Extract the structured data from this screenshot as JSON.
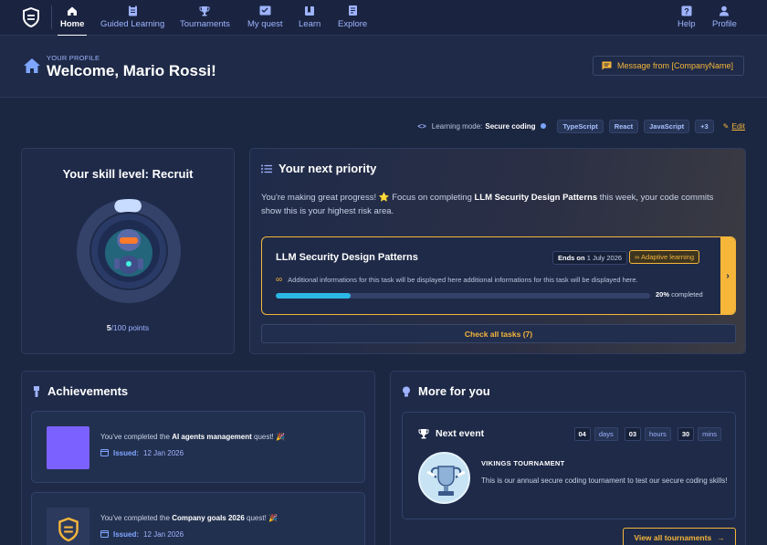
{
  "nav": {
    "items": [
      {
        "label": "Home",
        "icon": "home-icon",
        "active": true
      },
      {
        "label": "Guided Learning",
        "icon": "clipboard-icon"
      },
      {
        "label": "Tournaments",
        "icon": "trophy-icon"
      },
      {
        "label": "My quest",
        "icon": "quest-icon"
      },
      {
        "label": "Learn",
        "icon": "book-icon"
      },
      {
        "label": "Explore",
        "icon": "document-icon"
      }
    ],
    "right": [
      {
        "label": "Help",
        "icon": "help-icon"
      },
      {
        "label": "Profile",
        "icon": "user-icon"
      }
    ]
  },
  "header": {
    "kicker": "YOUR PROFILE",
    "welcome": "Welcome, Mario Rossi!",
    "message_button": "Message from [CompanyName]"
  },
  "mode": {
    "label": "Learning mode:",
    "value": "Secure coding",
    "chips": [
      "TypeScript",
      "React",
      "JavaScript",
      "+3"
    ],
    "edit": "Edit"
  },
  "skill": {
    "title": "Your skill level: Recruit",
    "points_value": "5",
    "points_rest": "/100 points",
    "progress": 0.05
  },
  "priority": {
    "title": "Your next priority",
    "text_a": "You're making great progress! ⭐ Focus on completing ",
    "text_bold": "LLM Security Design Patterns",
    "text_b": " this week, your code commits show this is your highest risk area.",
    "task": {
      "title": "LLM Security Design Patterns",
      "ends_label": "Ends on",
      "ends_date": "1 July 2026",
      "adaptive": "Adaptive learning",
      "info": "Additional informations for this task will be displayed here additional informations for this task will be displayed here.",
      "progress_percent": 20,
      "pct_value": "20%",
      "pct_label": "completed"
    },
    "check_all": "Check all tasks (7)"
  },
  "achievements": {
    "title": "Achievements",
    "items": [
      {
        "pre": "You've completed the ",
        "bold": "AI agents management",
        "post": " quest! 🎉",
        "issued_label": "Issued:",
        "date": "12 Jan 2026",
        "badge_color": "#7b61ff"
      },
      {
        "pre": "You've completed the ",
        "bold": "Company goals 2026",
        "post": " quest! 🎉",
        "issued_label": "Issued:",
        "date": "12 Jan 2026",
        "badge_color": "#2c3a5e"
      }
    ]
  },
  "more": {
    "title": "More for you",
    "event": {
      "title": "Next event",
      "days": "04",
      "days_unit": "days",
      "hours": "03",
      "hours_unit": "hours",
      "mins": "30",
      "mins_unit": "mins",
      "name": "VIKINGS TOURNAMENT",
      "desc": "This is our annual secure coding tournament to test our secure coding skills!"
    },
    "view_all": "View all tournaments"
  },
  "colors": {
    "accent": "#f5b63a",
    "link": "#9fb3ff",
    "progress": "#2bb8e6",
    "bg": "#1b2641"
  }
}
